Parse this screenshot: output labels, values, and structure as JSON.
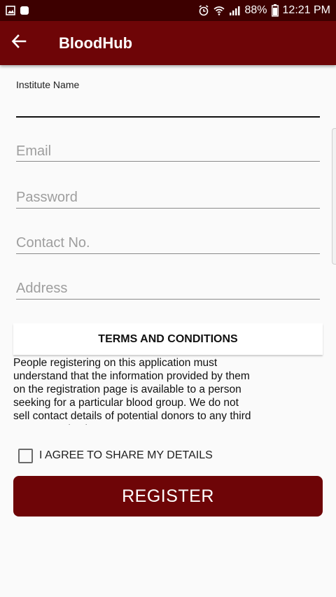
{
  "status_bar": {
    "battery": "88%",
    "time": "12:21 PM"
  },
  "app_bar": {
    "title": "BloodHub"
  },
  "form": {
    "institute_label": "Institute Name",
    "institute_value": "",
    "email_placeholder": "Email",
    "password_placeholder": "Password",
    "contact_placeholder": "Contact No.",
    "address_placeholder": "Address"
  },
  "terms": {
    "header": "TERMS AND CONDITIONS",
    "body": "People registering on this application must understand that the information provided by them on the registration page is available to a person seeking for a particular blood group. We do not sell contact details of potential donors to any third party organisations."
  },
  "agree": {
    "label": "I AGREE TO SHARE MY DETAILS",
    "checked": false
  },
  "register_button": "REGISTER",
  "colors": {
    "status_bar": "#3d0000",
    "app_bar": "#6e0507",
    "button": "#6e0507"
  }
}
